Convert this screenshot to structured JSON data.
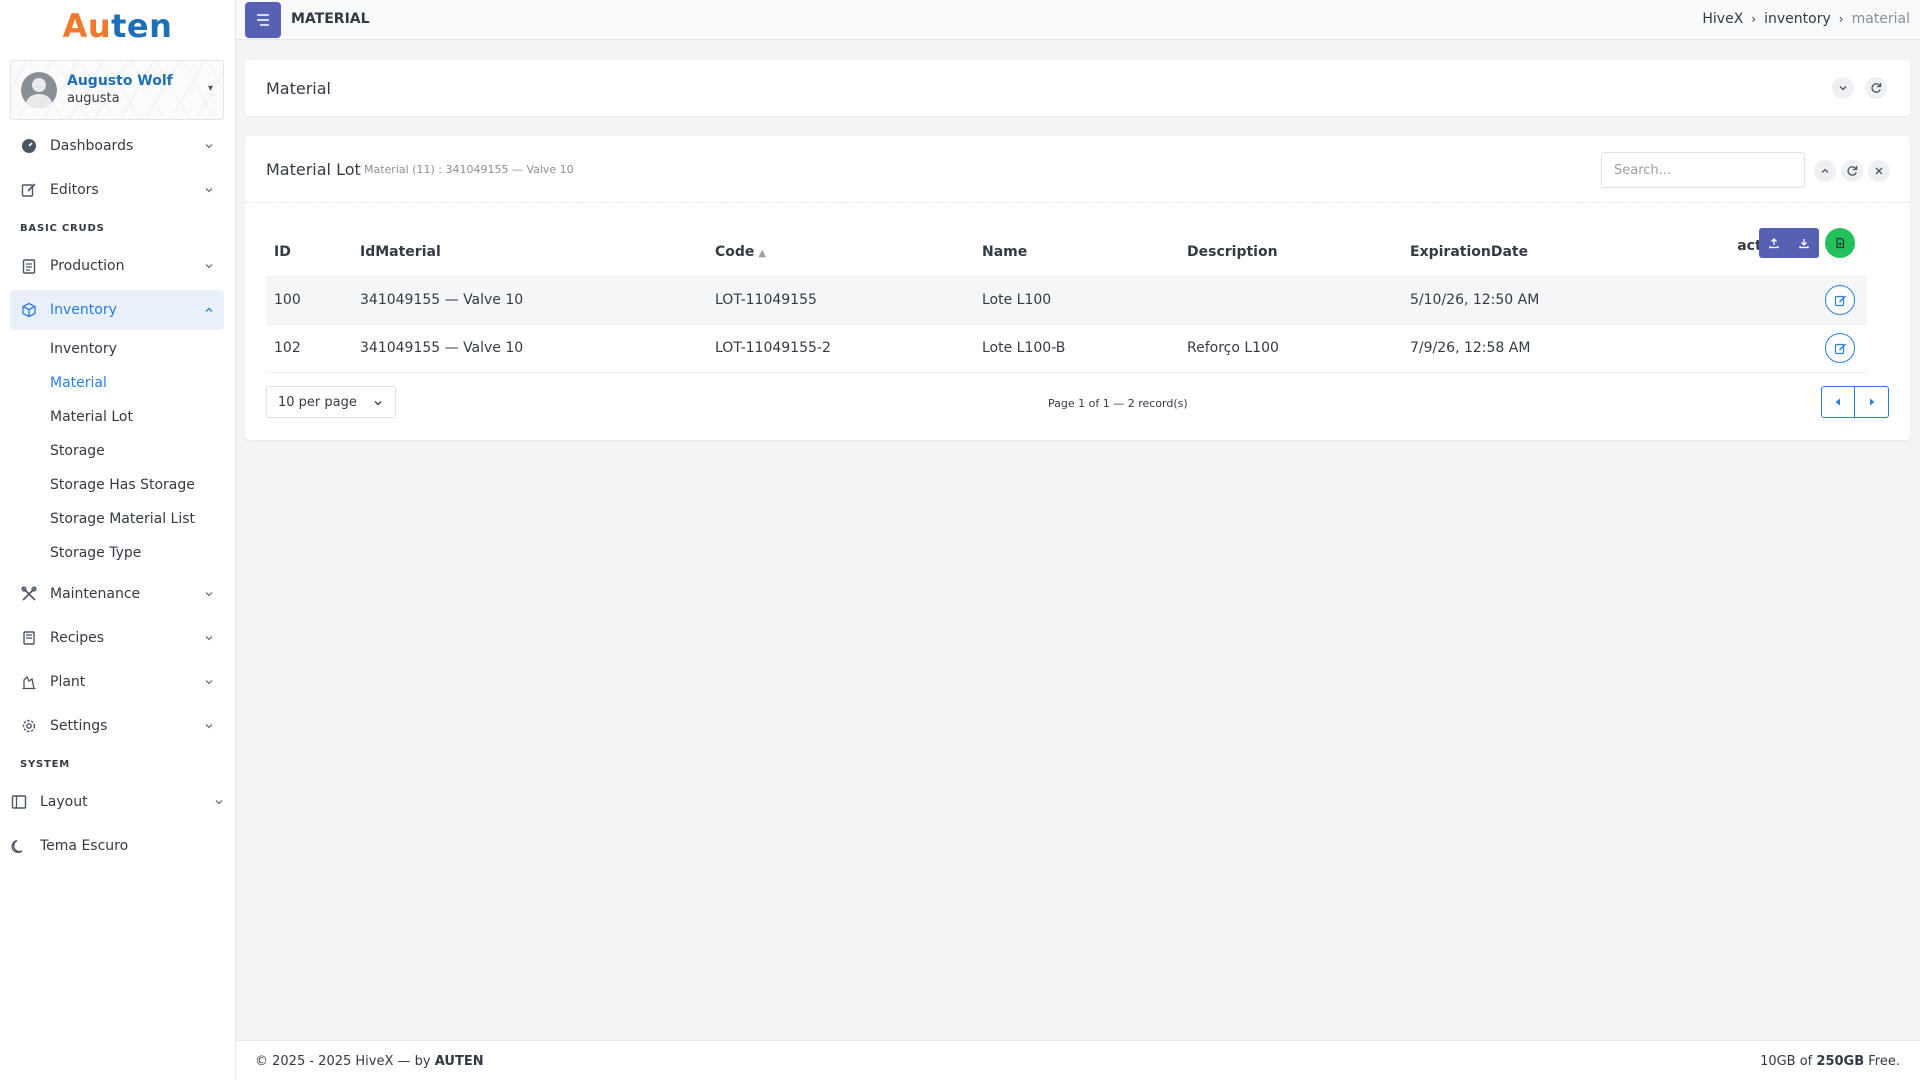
{
  "brand": {
    "logo_part1": "Au",
    "logo_part2": "ten",
    "accent": "#2a7de1",
    "logo_orange": "#f07a2c",
    "logo_blue": "#1f6fb6"
  },
  "user": {
    "name": "Augusto Wolf",
    "login": "augusta"
  },
  "sidebar": {
    "items_top": [
      {
        "label": "Dashboards",
        "icon": "gauge-icon"
      },
      {
        "label": "Editors",
        "icon": "edit-icon"
      }
    ],
    "section_basic": "BASIC CRUDS",
    "items_basic": [
      {
        "label": "Production",
        "icon": "clipboard-icon"
      },
      {
        "label": "Inventory",
        "icon": "box-icon"
      }
    ],
    "inventory_sub": [
      "Inventory",
      "Material",
      "Material Lot",
      "Storage",
      "Storage Has Storage",
      "Storage Material List",
      "Storage Type"
    ],
    "items_after": [
      {
        "label": "Maintenance",
        "icon": "tools-icon"
      },
      {
        "label": "Recipes",
        "icon": "book-icon"
      },
      {
        "label": "Plant",
        "icon": "factory-icon"
      },
      {
        "label": "Settings",
        "icon": "gear-icon"
      }
    ],
    "section_system": "SYSTEM",
    "system_items": [
      {
        "label": "Layout",
        "icon": "layout-icon"
      },
      {
        "label": "Tema Escuro",
        "icon": "moon-icon"
      }
    ]
  },
  "topbar": {
    "title": "MATERIAL",
    "breadcrumb": [
      "HiveX",
      "inventory",
      "material"
    ]
  },
  "material_card": {
    "title": "Material"
  },
  "lot_card": {
    "title": "Material Lot",
    "subtitle": "Material (11) : 341049155 — Valve 10",
    "search_placeholder": "Search...",
    "columns": [
      "ID",
      "IdMaterial",
      "Code",
      "Name",
      "Description",
      "ExpirationDate",
      "act."
    ],
    "rows": [
      {
        "id": "100",
        "idmaterial": "341049155 — Valve 10",
        "code": "LOT-11049155",
        "name": "Lote L100",
        "description": "",
        "expiration": "5/10/26, 12:50 AM"
      },
      {
        "id": "102",
        "idmaterial": "341049155 — Valve 10",
        "code": "LOT-11049155-2",
        "name": "Lote L100-B",
        "description": "Reforço L100",
        "expiration": "7/9/26, 12:58 AM"
      }
    ],
    "per_page": "10 per page",
    "page_info": "Page 1 of 1 — 2 record(s)"
  },
  "footer": {
    "left_prefix": "© 2025 - 2025 HiveX — by",
    "left_brand": "AUTEN",
    "right_prefix": "10GB of",
    "right_total": "250GB",
    "right_suffix": "Free."
  }
}
